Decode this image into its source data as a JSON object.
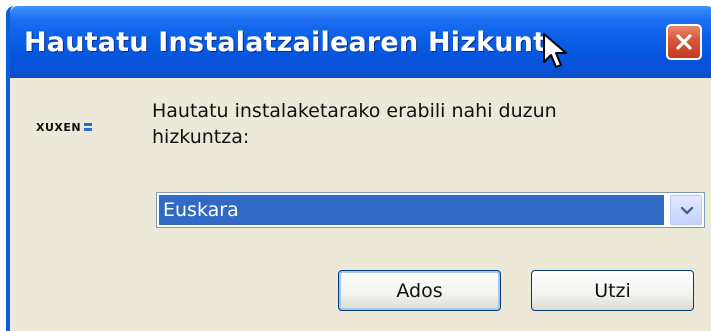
{
  "window": {
    "title": "Hautatu Instalatzailearen Hizkuntza"
  },
  "logo": {
    "text": "XUXEN"
  },
  "prompt": {
    "text": "Hautatu instalaketarako erabili nahi duzun hizkuntza:"
  },
  "language_select": {
    "selected": "Euskara"
  },
  "buttons": {
    "ok_label": "Ados",
    "cancel_label": "Utzi"
  },
  "icons": {
    "close": "close-icon",
    "dropdown": "chevron-down-icon",
    "cursor": "mouse-pointer-icon"
  },
  "colors": {
    "titlebar": "#0a5fe6",
    "close_button": "#d8553a",
    "selection": "#316ac5",
    "window_background": "#ece9d8"
  }
}
